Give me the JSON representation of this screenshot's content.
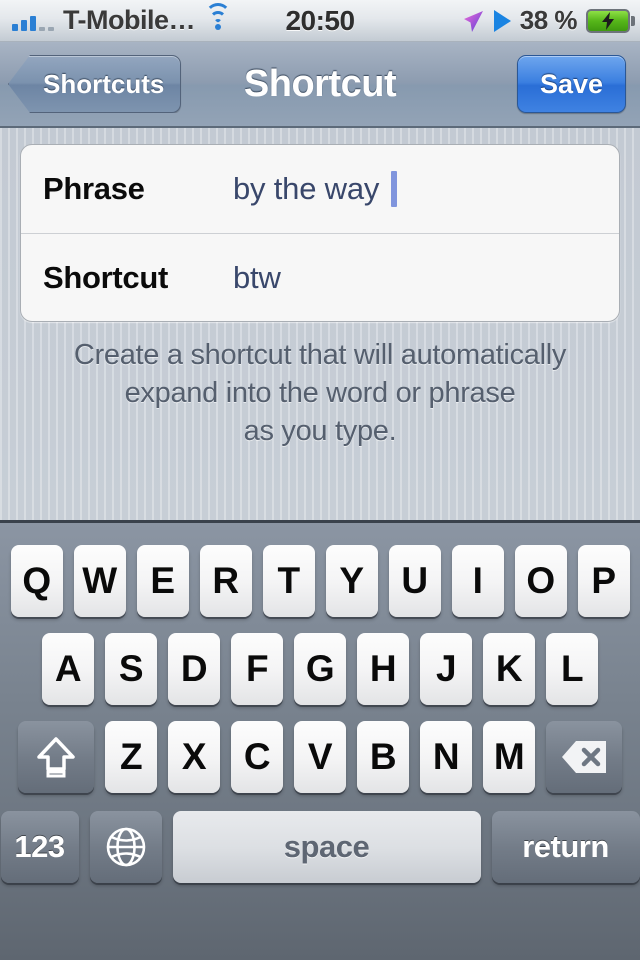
{
  "status_bar": {
    "carrier": "T-Mobile…",
    "signal_icon": "signal-bars-icon",
    "signal_bars_filled": 3,
    "signal_bars_total": 5,
    "wifi_icon": "wifi-icon",
    "time": "20:50",
    "location_icon": "location-arrow-icon",
    "play_icon": "play-triangle-icon",
    "battery_percent": "38 %",
    "battery_icon": "battery-charging-icon",
    "accent_blue": "#2a7fd4",
    "battery_green": "#56b61a"
  },
  "nav_bar": {
    "back_label": "Shortcuts",
    "title": "Shortcut",
    "save_label": "Save",
    "save_color": "#3b7fe0"
  },
  "form": {
    "rows": [
      {
        "label": "Phrase",
        "value": "by the way",
        "has_caret": true
      },
      {
        "label": "Shortcut",
        "value": "btw",
        "has_caret": false
      }
    ],
    "value_color": "#39476b",
    "caret_color": "#8095dd"
  },
  "footnote": {
    "line1": "Create a shortcut that will automatically",
    "line2": "expand into the word or phrase",
    "line3": "as you type."
  },
  "keyboard": {
    "row1": [
      "Q",
      "W",
      "E",
      "R",
      "T",
      "Y",
      "U",
      "I",
      "O",
      "P"
    ],
    "row2": [
      "A",
      "S",
      "D",
      "F",
      "G",
      "H",
      "J",
      "K",
      "L"
    ],
    "row3": [
      "Z",
      "X",
      "C",
      "V",
      "B",
      "N",
      "M"
    ],
    "shift_icon": "shift-arrow-icon",
    "delete_icon": "delete-backspace-icon",
    "numeric_label": "123",
    "globe_icon": "globe-keyboard-icon",
    "space_label": "space",
    "return_label": "return"
  }
}
